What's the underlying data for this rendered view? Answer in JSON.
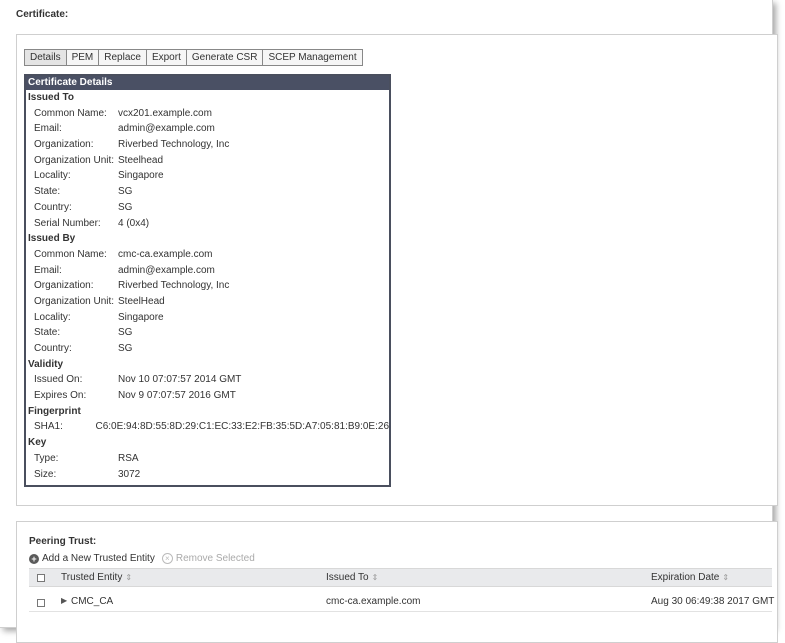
{
  "certificate": {
    "title": "Certificate:",
    "tabs": [
      "Details",
      "PEM",
      "Replace",
      "Export",
      "Generate CSR",
      "SCEP Management"
    ],
    "details_title": "Certificate Details",
    "issued_to": {
      "heading": "Issued To",
      "rows": [
        {
          "k": "Common Name:",
          "v": "vcx201.example.com"
        },
        {
          "k": "Email:",
          "v": "admin@example.com"
        },
        {
          "k": "Organization:",
          "v": "Riverbed Technology, Inc"
        },
        {
          "k": "Organization Unit:",
          "v": "Steelhead"
        },
        {
          "k": "Locality:",
          "v": "Singapore"
        },
        {
          "k": "State:",
          "v": "SG"
        },
        {
          "k": "Country:",
          "v": "SG"
        },
        {
          "k": "Serial Number:",
          "v": "4 (0x4)"
        }
      ]
    },
    "issued_by": {
      "heading": "Issued By",
      "rows": [
        {
          "k": "Common Name:",
          "v": "cmc-ca.example.com"
        },
        {
          "k": "Email:",
          "v": "admin@example.com"
        },
        {
          "k": "Organization:",
          "v": "Riverbed Technology, Inc"
        },
        {
          "k": "Organization Unit:",
          "v": "SteelHead"
        },
        {
          "k": "Locality:",
          "v": "Singapore"
        },
        {
          "k": "State:",
          "v": "SG"
        },
        {
          "k": "Country:",
          "v": "SG"
        }
      ]
    },
    "validity": {
      "heading": "Validity",
      "rows": [
        {
          "k": "Issued On:",
          "v": "Nov 10 07:07:57 2014 GMT"
        },
        {
          "k": "Expires On:",
          "v": "Nov 9 07:07:57 2016 GMT"
        }
      ]
    },
    "fingerprint": {
      "heading": "Fingerprint",
      "rows": [
        {
          "k": "SHA1:",
          "v": "C6:0E:94:8D:55:8D:29:C1:EC:33:E2:FB:35:5D:A7:05:81:B9:0E:26"
        }
      ]
    },
    "key": {
      "heading": "Key",
      "rows": [
        {
          "k": "Type:",
          "v": "RSA"
        },
        {
          "k": "Size:",
          "v": "3072"
        }
      ]
    }
  },
  "peering": {
    "title": "Peering Trust:",
    "add_label": "Add a New Trusted Entity",
    "remove_label": "Remove Selected",
    "columns": [
      "Trusted Entity",
      "Issued To",
      "Expiration Date"
    ],
    "rows": [
      {
        "entity": "CMC_CA",
        "issued_to": "cmc-ca.example.com",
        "expiration": "Aug 30 06:49:38 2017 GMT"
      }
    ]
  }
}
